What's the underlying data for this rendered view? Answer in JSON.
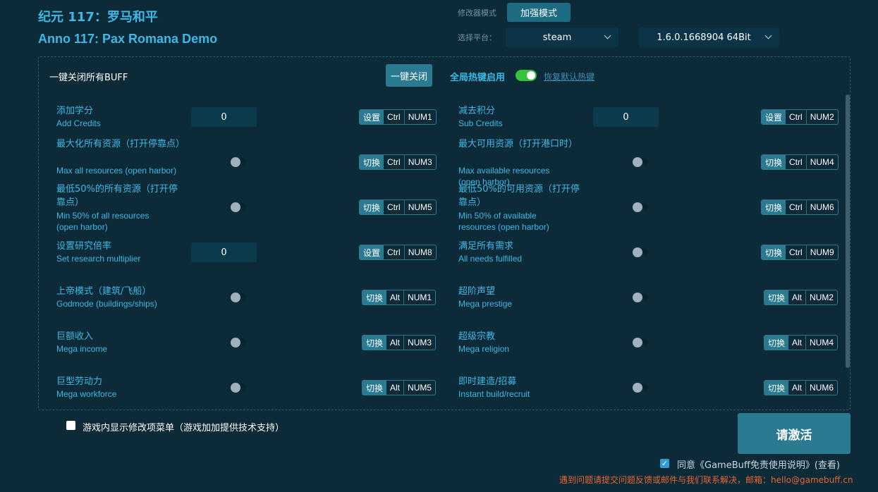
{
  "header": {
    "title_cn": "纪元 117：罗马和平",
    "title_en": "Anno 117: Pax Romana Demo",
    "mode_label": "修改器模式",
    "mode_button": "加强模式",
    "platform_label": "选择平台：",
    "platform_value": "steam",
    "version_value": "1.6.0.1668904 64Bit"
  },
  "panel": {
    "close_all_label": "一键关闭所有BUFF",
    "close_all_button": "一键关闭",
    "global_hotkey_label": "全局热键启用",
    "global_hotkey_enabled": true,
    "reset_hotkeys_link": "恢复默认热键"
  },
  "options": [
    {
      "cn": "添加学分",
      "en": "Add Credits",
      "control": "input",
      "value": "0",
      "action": "设置",
      "mod": "Ctrl",
      "key": "NUM1"
    },
    {
      "cn": "减去积分",
      "en": "Sub Credits",
      "control": "input",
      "value": "0",
      "action": "设置",
      "mod": "Ctrl",
      "key": "NUM2"
    },
    {
      "cn": "最大化所有资源（打开停靠点）",
      "en": "Max all resources (open harbor)",
      "control": "toggle",
      "on": false,
      "action": "切换",
      "mod": "Ctrl",
      "key": "NUM3"
    },
    {
      "cn": "最大可用资源（打开港口时）",
      "en": "Max available resources (open harbor)",
      "control": "toggle",
      "on": false,
      "action": "切换",
      "mod": "Ctrl",
      "key": "NUM4"
    },
    {
      "cn": "最低50%的所有资源（打开停靠点）",
      "en": "Min 50% of all resources (open harbor)",
      "control": "toggle",
      "on": false,
      "action": "切换",
      "mod": "Ctrl",
      "key": "NUM5"
    },
    {
      "cn": "最低50%的可用资源（打开停靠点）",
      "en": "Min 50% of available resources (open harbor)",
      "control": "toggle",
      "on": false,
      "action": "切换",
      "mod": "Ctrl",
      "key": "NUM6"
    },
    {
      "cn": "设置研究倍率",
      "en": "Set research multiplier",
      "control": "input",
      "value": "0",
      "action": "设置",
      "mod": "Ctrl",
      "key": "NUM8"
    },
    {
      "cn": "满足所有需求",
      "en": "All needs fulfilled",
      "control": "toggle",
      "on": false,
      "action": "切换",
      "mod": "Ctrl",
      "key": "NUM9"
    },
    {
      "cn": "上帝模式（建筑/飞船）",
      "en": "Godmode (buildings/ships)",
      "control": "toggle",
      "on": false,
      "action": "切换",
      "mod": "Alt",
      "key": "NUM1"
    },
    {
      "cn": "超阶声望",
      "en": "Mega prestige",
      "control": "toggle",
      "on": false,
      "action": "切换",
      "mod": "Alt",
      "key": "NUM2"
    },
    {
      "cn": "巨额收入",
      "en": "Mega income",
      "control": "toggle",
      "on": false,
      "action": "切换",
      "mod": "Alt",
      "key": "NUM3"
    },
    {
      "cn": "超级宗教",
      "en": "Mega religion",
      "control": "toggle",
      "on": false,
      "action": "切换",
      "mod": "Alt",
      "key": "NUM4"
    },
    {
      "cn": "巨型劳动力",
      "en": "Mega workforce",
      "control": "toggle",
      "on": false,
      "action": "切换",
      "mod": "Alt",
      "key": "NUM5"
    },
    {
      "cn": "即时建造/招募",
      "en": "Instant build/recruit",
      "control": "toggle",
      "on": false,
      "action": "切换",
      "mod": "Alt",
      "key": "NUM6"
    }
  ],
  "footer": {
    "ingame_menu_label": "游戏内显示修改项菜单（游戏加加提供技术支持）",
    "ingame_menu_checked": false,
    "activate_button": "请激活",
    "agree_label": "同意《GameBuff免责使用说明》(查看)",
    "agree_checked": true,
    "contact_text": "遇到问题请提交问题反馈或邮件与我们联系解决，邮箱：hello@gamebuff.cn"
  },
  "colors": {
    "background": "#0d2a38",
    "accent": "#3db9e6",
    "button": "#2a7b92",
    "toggle_on": "#35c23c",
    "warning_text": "#e6662f"
  }
}
